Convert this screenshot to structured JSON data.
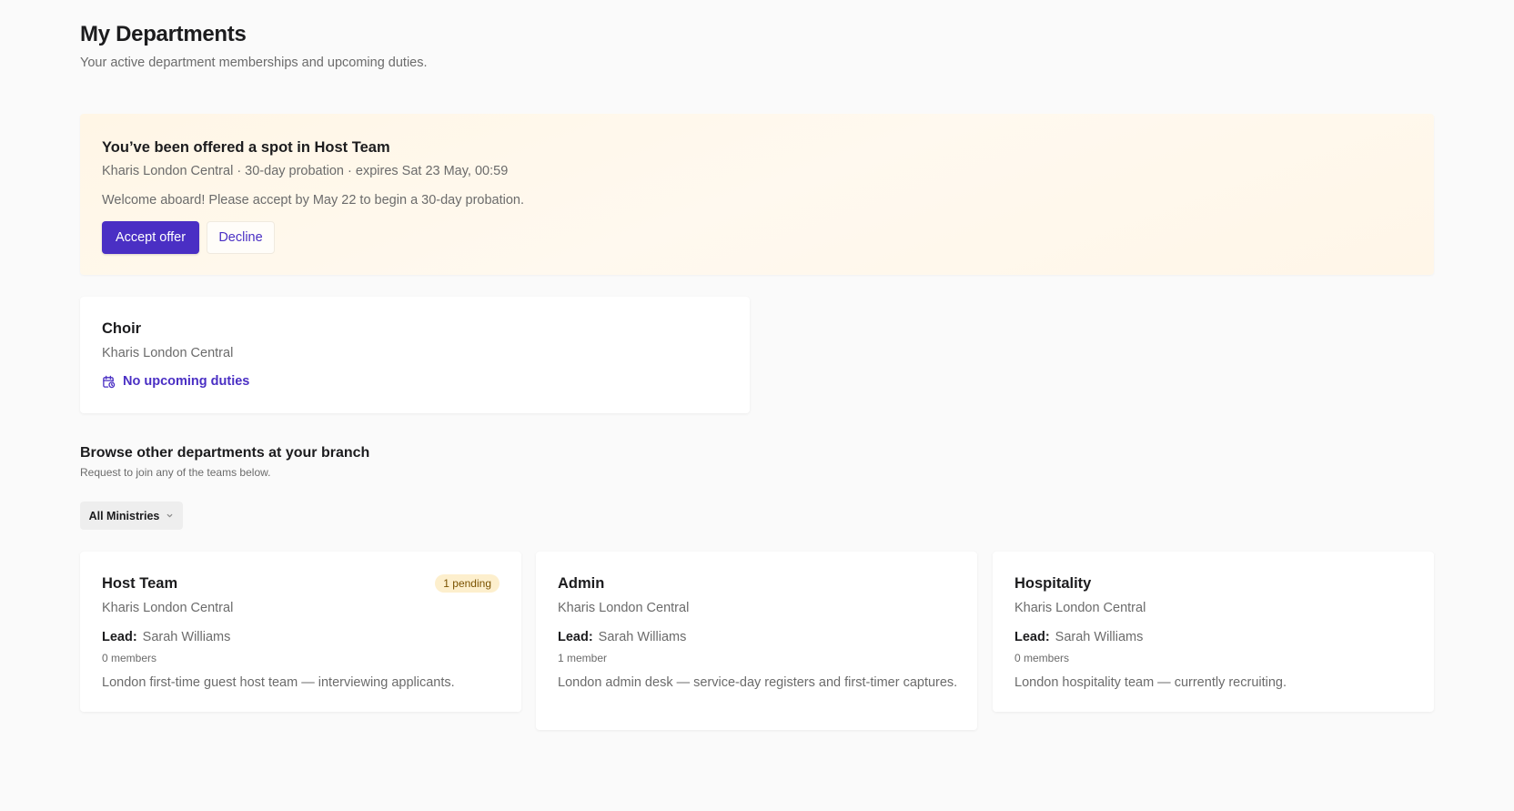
{
  "header": {
    "title": "My Departments",
    "subtitle": "Your active department memberships and upcoming duties."
  },
  "offer": {
    "title": "You’ve been offered a spot in Host Team",
    "meta": "Kharis London Central · 30-day probation · expires Sat 23 May, 00:59",
    "message": "Welcome aboard! Please accept by May 22 to begin a 30-day probation.",
    "accept_label": "Accept offer",
    "decline_label": "Decline"
  },
  "memberships": [
    {
      "name": "Choir",
      "branch": "Kharis London Central",
      "duties_label": "No upcoming duties",
      "duties_icon": "calendar-clock-icon"
    }
  ],
  "browse": {
    "title": "Browse other departments at your branch",
    "subtitle": "Request to join any of the teams below.",
    "filter_label": "All Ministries",
    "filter_icon": "chevron-down-icon"
  },
  "departments": [
    {
      "name": "Host Team",
      "badge": "1 pending",
      "branch": "Kharis London Central",
      "lead_label": "Lead:",
      "lead": "Sarah Williams",
      "members": "0 members",
      "description": "London first-time guest host team — interviewing applicants."
    },
    {
      "name": "Admin",
      "branch": "Kharis London Central",
      "lead_label": "Lead:",
      "lead": "Sarah Williams",
      "members": "1 member",
      "description": "London admin desk — service-day registers and first-timer captures."
    },
    {
      "name": "Hospitality",
      "branch": "Kharis London Central",
      "lead_label": "Lead:",
      "lead": "Sarah Williams",
      "members": "0 members",
      "description": "London hospitality team — currently recruiting."
    }
  ],
  "colors": {
    "accent": "#4a2fc4",
    "offer_background": "#fff7ea",
    "badge_background": "#fdefcd",
    "badge_text": "#7a5200"
  }
}
